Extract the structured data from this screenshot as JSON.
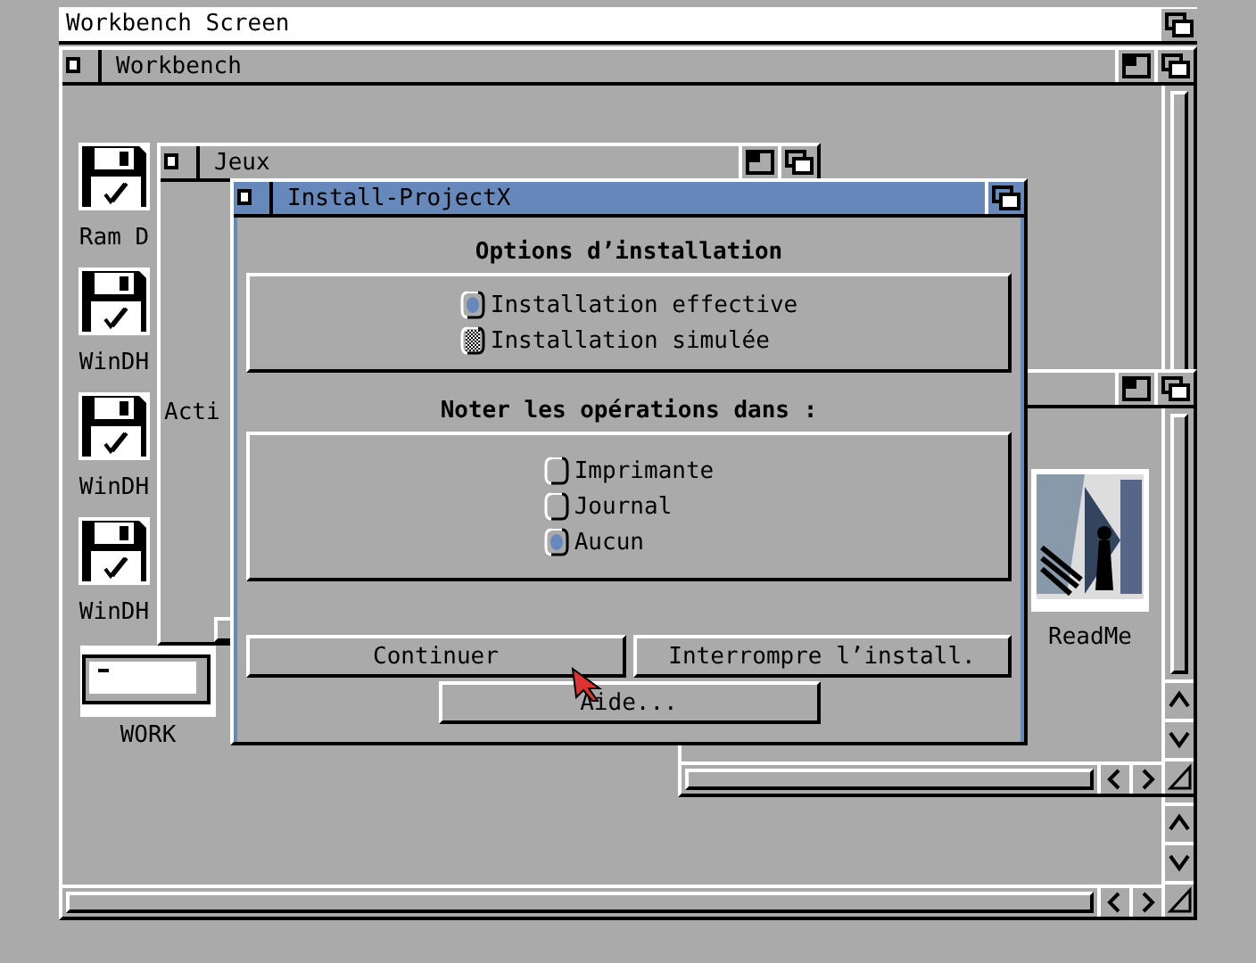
{
  "screen": {
    "title": "Workbench Screen"
  },
  "workbench_window": {
    "title": "Workbench",
    "icons": [
      {
        "label": "Ram D",
        "kind": "disk"
      },
      {
        "label": "WinDH",
        "kind": "disk"
      },
      {
        "label": "WinDH",
        "kind": "disk"
      },
      {
        "label": "WinDH",
        "kind": "disk"
      },
      {
        "label": "WORK",
        "kind": "drive"
      }
    ]
  },
  "jeux_window": {
    "title": "Jeux",
    "text": "Acti"
  },
  "drawer_window": {
    "icons": [
      {
        "label": "ReadMe",
        "kind": "picture"
      }
    ]
  },
  "dialog": {
    "title": "Install-ProjectX",
    "groups": [
      {
        "heading": "Options d’installation",
        "options": [
          {
            "label": "Installation effective",
            "selected": true,
            "disabled": false
          },
          {
            "label": "Installation simulée",
            "selected": false,
            "disabled": true
          }
        ]
      },
      {
        "heading": "Noter les opérations dans :",
        "options": [
          {
            "label": "Imprimante",
            "selected": false,
            "disabled": false
          },
          {
            "label": "Journal",
            "selected": false,
            "disabled": false
          },
          {
            "label": "Aucun",
            "selected": true,
            "disabled": false
          }
        ]
      }
    ],
    "buttons": [
      "Continuer",
      "Interrompre l’install.",
      "Aide..."
    ]
  }
}
